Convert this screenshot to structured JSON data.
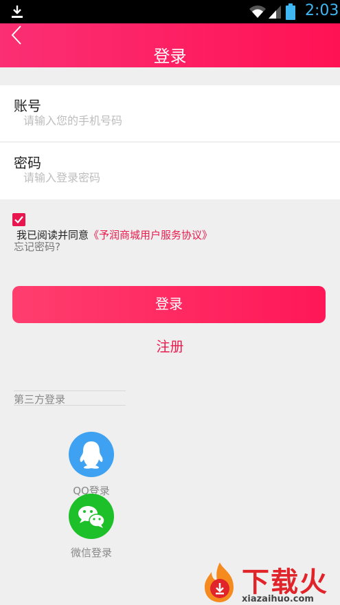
{
  "status_bar": {
    "time": "2:03",
    "icons": [
      "download-icon",
      "wifi-icon",
      "signal-icon",
      "battery-icon"
    ],
    "time_color": "#3fb7f2"
  },
  "header": {
    "title": "登录",
    "back_icon": "chevron-left-icon",
    "gradient_start": "#fb2f74",
    "gradient_end": "#ff1254"
  },
  "form": {
    "account": {
      "label": "账号",
      "value": "",
      "placeholder": "请输入您的手机号码"
    },
    "password": {
      "label": "密码",
      "value": "",
      "placeholder": "请输入登录密码"
    }
  },
  "agreement": {
    "checked": true,
    "prefix": "我已阅读并同意",
    "link": "《予润商城用户服务协议》"
  },
  "forgot_password": "忘记密码?",
  "login_button": "登录",
  "register_link": "注册",
  "third_party": {
    "title": "第三方登录",
    "providers": [
      {
        "label": "QQ登录",
        "icon": "qq-icon",
        "color": "#3ea1f1"
      },
      {
        "label": "微信登录",
        "icon": "wechat-icon",
        "color": "#1ec02a"
      }
    ]
  },
  "watermark": {
    "text": "下载火",
    "url": "xiazaihuo.com"
  },
  "accent_color": "#e81b4d"
}
